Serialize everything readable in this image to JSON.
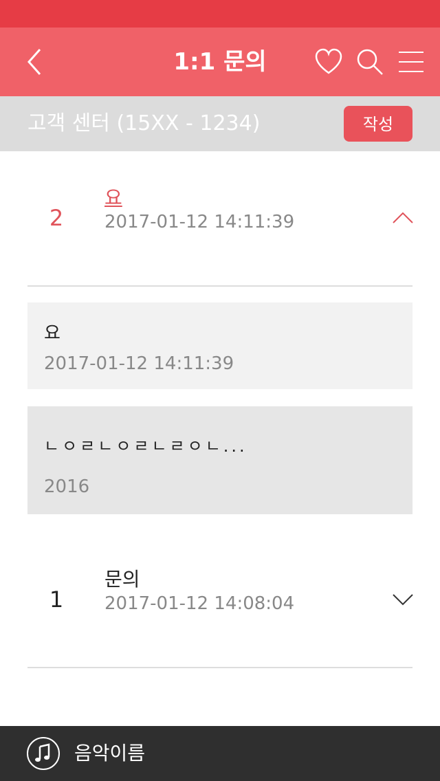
{
  "header": {
    "title": "1:1 문의",
    "icons": [
      "back-icon",
      "heart-icon",
      "search-icon",
      "menu-icon"
    ]
  },
  "subheader": {
    "title": "고객 센터 (15XX - 1234)",
    "write_label": "작성"
  },
  "inquiries": [
    {
      "number": "2",
      "subject": "요",
      "date": "2017-01-12 14:11:39",
      "expanded": true,
      "question": {
        "text": "요",
        "date": "2017-01-12 14:11:39"
      },
      "answer": {
        "text": "ㄴㅇㄹㄴㅇㄹㄴㄹㅇㄴ...",
        "date": "2016"
      }
    },
    {
      "number": "1",
      "subject": "문의",
      "date": "2017-01-12 14:08:04",
      "expanded": false
    }
  ],
  "player": {
    "track_name": "음악이름",
    "icon": "music-note-icon"
  },
  "colors": {
    "status_bar": "#e63c45",
    "header": "#f06168",
    "accent": "#e0535a",
    "subheader_bg": "#dcdcdc",
    "player_bg": "#2f2f2f"
  }
}
